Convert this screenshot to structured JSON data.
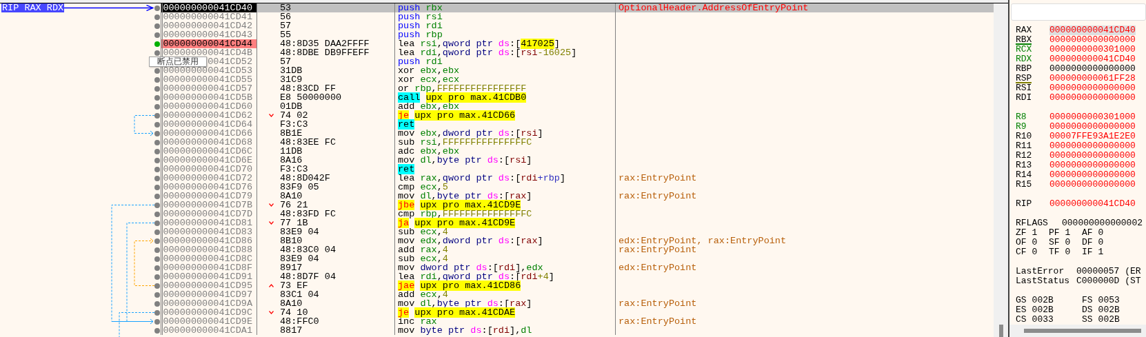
{
  "gutter": {
    "rip_label": "RIP RAX RDX"
  },
  "rows": [
    {
      "address": "000000000041CD40",
      "bytes": "53",
      "mnemonic": {
        "text": "push",
        "kind": "stack"
      },
      "operands": [
        {
          "text": "rbx",
          "kind": "reg"
        }
      ],
      "comment": {
        "text": "OptionalHeader.AddressOfEntryPoint",
        "kind": "label"
      },
      "selected": true,
      "current": true,
      "breakpoint": false
    },
    {
      "address": "000000000041CD41",
      "bytes": "56",
      "mnemonic": {
        "text": "push",
        "kind": "stack"
      },
      "operands": [
        {
          "text": "rsi",
          "kind": "reg"
        }
      ],
      "selected": false,
      "current": false,
      "breakpoint": false
    },
    {
      "address": "000000000041CD42",
      "bytes": "57",
      "mnemonic": {
        "text": "push",
        "kind": "stack"
      },
      "operands": [
        {
          "text": "rdi",
          "kind": "reg"
        }
      ],
      "selected": false,
      "current": false,
      "breakpoint": false
    },
    {
      "address": "000000000041CD43",
      "bytes": "55",
      "mnemonic": {
        "text": "push",
        "kind": "stack"
      },
      "operands": [
        {
          "text": "rbp",
          "kind": "reg"
        }
      ],
      "selected": false,
      "current": false,
      "breakpoint": false
    },
    {
      "address": "000000000041CD44",
      "bytes": "48:8D35 DAA2FFFF",
      "mnemonic": {
        "text": "lea",
        "kind": "plain"
      },
      "operands": [
        {
          "text": "rsi",
          "kind": "reg"
        },
        {
          "text": ",",
          "kind": "p"
        },
        {
          "text": "qword ptr ",
          "kind": "size"
        },
        {
          "text": "ds",
          "kind": "seg"
        },
        {
          "text": ":[",
          "kind": "p"
        },
        {
          "text": "417025",
          "kind": "mark"
        },
        {
          "text": "]",
          "kind": "p"
        }
      ],
      "selected": false,
      "current": false,
      "breakpoint": true
    },
    {
      "address": "000000000041CD4B",
      "bytes": "48:8DBE DB9FFEFF",
      "mnemonic": {
        "text": "lea",
        "kind": "plain"
      },
      "operands": [
        {
          "text": "rdi",
          "kind": "reg"
        },
        {
          "text": ",",
          "kind": "p"
        },
        {
          "text": "qword ptr ",
          "kind": "size"
        },
        {
          "text": "ds",
          "kind": "seg"
        },
        {
          "text": ":[",
          "kind": "p"
        },
        {
          "text": "rsi",
          "kind": "mem"
        },
        {
          "text": "-16025",
          "kind": "num"
        },
        {
          "text": "]",
          "kind": "p"
        }
      ],
      "selected": false,
      "current": false,
      "breakpoint": false
    },
    {
      "address": "0041CD52",
      "bytes": "57",
      "mnemonic": {
        "text": "push",
        "kind": "stack"
      },
      "operands": [
        {
          "text": "rdi",
          "kind": "reg"
        }
      ],
      "tooltip": "断点已禁用",
      "selected": false,
      "current": false,
      "breakpoint": false
    },
    {
      "address": "000000000041CD53",
      "bytes": "31DB",
      "mnemonic": {
        "text": "xor",
        "kind": "plain"
      },
      "operands": [
        {
          "text": "ebx",
          "kind": "reg"
        },
        {
          "text": ",",
          "kind": "p"
        },
        {
          "text": "ebx",
          "kind": "reg"
        }
      ],
      "selected": false,
      "current": false,
      "breakpoint": false
    },
    {
      "address": "000000000041CD55",
      "bytes": "31C9",
      "mnemonic": {
        "text": "xor",
        "kind": "plain"
      },
      "operands": [
        {
          "text": "ecx",
          "kind": "reg"
        },
        {
          "text": ",",
          "kind": "p"
        },
        {
          "text": "ecx",
          "kind": "reg"
        }
      ],
      "selected": false,
      "current": false,
      "breakpoint": false
    },
    {
      "address": "000000000041CD57",
      "bytes": "48:83CD FF",
      "mnemonic": {
        "text": "or",
        "kind": "plain"
      },
      "operands": [
        {
          "text": "rbp",
          "kind": "reg"
        },
        {
          "text": ",",
          "kind": "p"
        },
        {
          "text": "FFFFFFFFFFFFFFFF",
          "kind": "num"
        }
      ],
      "selected": false,
      "current": false,
      "breakpoint": false
    },
    {
      "address": "000000000041CD5B",
      "bytes": "E8 50000000",
      "mnemonic": {
        "text": "call",
        "kind": "call"
      },
      "operands": [
        {
          "text": "upx pro max.41CDB0",
          "kind": "target"
        }
      ],
      "selected": false,
      "current": false,
      "breakpoint": false
    },
    {
      "address": "000000000041CD60",
      "bytes": "01DB",
      "mnemonic": {
        "text": "add",
        "kind": "plain"
      },
      "operands": [
        {
          "text": "ebx",
          "kind": "reg"
        },
        {
          "text": ",",
          "kind": "p"
        },
        {
          "text": "ebx",
          "kind": "reg"
        }
      ],
      "selected": false,
      "current": false,
      "breakpoint": false
    },
    {
      "address": "000000000041CD62",
      "bytes": "74 02",
      "backward": false,
      "mnemonic": {
        "text": "je",
        "kind": "jump"
      },
      "operands": [
        {
          "text": "upx pro max.41CD66",
          "kind": "target"
        }
      ],
      "selected": false,
      "current": false,
      "breakpoint": false
    },
    {
      "address": "000000000041CD64",
      "bytes": "F3:C3",
      "mnemonic": {
        "text": "ret",
        "kind": "call"
      },
      "selected": false,
      "current": false,
      "breakpoint": false
    },
    {
      "address": "000000000041CD66",
      "bytes": "8B1E",
      "mnemonic": {
        "text": "mov",
        "kind": "plain"
      },
      "operands": [
        {
          "text": "ebx",
          "kind": "reg"
        },
        {
          "text": ",",
          "kind": "p"
        },
        {
          "text": "dword ptr ",
          "kind": "size"
        },
        {
          "text": "ds",
          "kind": "seg"
        },
        {
          "text": ":[",
          "kind": "p"
        },
        {
          "text": "rsi",
          "kind": "mem"
        },
        {
          "text": "]",
          "kind": "p"
        }
      ],
      "selected": false,
      "current": false,
      "breakpoint": false
    },
    {
      "address": "000000000041CD68",
      "bytes": "48:83EE FC",
      "mnemonic": {
        "text": "sub",
        "kind": "plain"
      },
      "operands": [
        {
          "text": "rsi",
          "kind": "reg"
        },
        {
          "text": ",",
          "kind": "p"
        },
        {
          "text": "FFFFFFFFFFFFFFFC",
          "kind": "num"
        }
      ],
      "selected": false,
      "current": false,
      "breakpoint": false
    },
    {
      "address": "000000000041CD6C",
      "bytes": "11DB",
      "mnemonic": {
        "text": "adc",
        "kind": "plain"
      },
      "operands": [
        {
          "text": "ebx",
          "kind": "reg"
        },
        {
          "text": ",",
          "kind": "p"
        },
        {
          "text": "ebx",
          "kind": "reg"
        }
      ],
      "selected": false,
      "current": false,
      "breakpoint": false
    },
    {
      "address": "000000000041CD6E",
      "bytes": "8A16",
      "mnemonic": {
        "text": "mov",
        "kind": "plain"
      },
      "operands": [
        {
          "text": "dl",
          "kind": "reg"
        },
        {
          "text": ",",
          "kind": "p"
        },
        {
          "text": "byte ptr ",
          "kind": "size"
        },
        {
          "text": "ds",
          "kind": "seg"
        },
        {
          "text": ":[",
          "kind": "p"
        },
        {
          "text": "rsi",
          "kind": "mem"
        },
        {
          "text": "]",
          "kind": "p"
        }
      ],
      "selected": false,
      "current": false,
      "breakpoint": false
    },
    {
      "address": "000000000041CD70",
      "bytes": "F3:C3",
      "mnemonic": {
        "text": "ret",
        "kind": "call"
      },
      "selected": false,
      "current": false,
      "breakpoint": false
    },
    {
      "address": "000000000041CD72",
      "bytes": "48:8D042F",
      "mnemonic": {
        "text": "lea",
        "kind": "plain"
      },
      "operands": [
        {
          "text": "rax",
          "kind": "reg"
        },
        {
          "text": ",",
          "kind": "p"
        },
        {
          "text": "qword ptr ",
          "kind": "size"
        },
        {
          "text": "ds",
          "kind": "seg"
        },
        {
          "text": ":[",
          "kind": "p"
        },
        {
          "text": "rdi",
          "kind": "mem"
        },
        {
          "text": "+rbp",
          "kind": "index"
        },
        {
          "text": "]",
          "kind": "p"
        }
      ],
      "comment": {
        "text": "rax:EntryPoint",
        "kind": "auto"
      },
      "selected": false,
      "current": false,
      "breakpoint": false
    },
    {
      "address": "000000000041CD76",
      "bytes": "83F9 05",
      "mnemonic": {
        "text": "cmp",
        "kind": "plain"
      },
      "operands": [
        {
          "text": "ecx",
          "kind": "reg"
        },
        {
          "text": ",",
          "kind": "p"
        },
        {
          "text": "5",
          "kind": "num"
        }
      ],
      "selected": false,
      "current": false,
      "breakpoint": false
    },
    {
      "address": "000000000041CD79",
      "bytes": "8A10",
      "mnemonic": {
        "text": "mov",
        "kind": "plain"
      },
      "operands": [
        {
          "text": "dl",
          "kind": "reg"
        },
        {
          "text": ",",
          "kind": "p"
        },
        {
          "text": "byte ptr ",
          "kind": "size"
        },
        {
          "text": "ds",
          "kind": "seg"
        },
        {
          "text": ":[",
          "kind": "p"
        },
        {
          "text": "rax",
          "kind": "mem"
        },
        {
          "text": "]",
          "kind": "p"
        }
      ],
      "comment": {
        "text": "rax:EntryPoint",
        "kind": "auto"
      },
      "selected": false,
      "current": false,
      "breakpoint": false
    },
    {
      "address": "000000000041CD7B",
      "bytes": "76 21",
      "backward": false,
      "mnemonic": {
        "text": "jbe",
        "kind": "jump"
      },
      "operands": [
        {
          "text": "upx pro max.41CD9E",
          "kind": "target"
        }
      ],
      "selected": false,
      "current": false,
      "breakpoint": false
    },
    {
      "address": "000000000041CD7D",
      "bytes": "48:83FD FC",
      "mnemonic": {
        "text": "cmp",
        "kind": "plain"
      },
      "operands": [
        {
          "text": "rbp",
          "kind": "reg"
        },
        {
          "text": ",",
          "kind": "p"
        },
        {
          "text": "FFFFFFFFFFFFFFFC",
          "kind": "num"
        }
      ],
      "selected": false,
      "current": false,
      "breakpoint": false
    },
    {
      "address": "000000000041CD81",
      "bytes": "77 1B",
      "backward": false,
      "mnemonic": {
        "text": "ja",
        "kind": "jump"
      },
      "operands": [
        {
          "text": "upx pro max.41CD9E",
          "kind": "target"
        }
      ],
      "selected": false,
      "current": false,
      "breakpoint": false
    },
    {
      "address": "000000000041CD83",
      "bytes": "83E9 04",
      "mnemonic": {
        "text": "sub",
        "kind": "plain"
      },
      "operands": [
        {
          "text": "ecx",
          "kind": "reg"
        },
        {
          "text": ",",
          "kind": "p"
        },
        {
          "text": "4",
          "kind": "num"
        }
      ],
      "selected": false,
      "current": false,
      "breakpoint": false
    },
    {
      "address": "000000000041CD86",
      "bytes": "8B10",
      "mnemonic": {
        "text": "mov",
        "kind": "plain"
      },
      "operands": [
        {
          "text": "edx",
          "kind": "reg"
        },
        {
          "text": ",",
          "kind": "p"
        },
        {
          "text": "dword ptr ",
          "kind": "size"
        },
        {
          "text": "ds",
          "kind": "seg"
        },
        {
          "text": ":[",
          "kind": "p"
        },
        {
          "text": "rax",
          "kind": "mem"
        },
        {
          "text": "]",
          "kind": "p"
        }
      ],
      "comment": {
        "text": "edx:EntryPoint, rax:EntryPoint",
        "kind": "auto"
      },
      "selected": false,
      "current": false,
      "breakpoint": false
    },
    {
      "address": "000000000041CD88",
      "bytes": "48:83C0 04",
      "mnemonic": {
        "text": "add",
        "kind": "plain"
      },
      "operands": [
        {
          "text": "rax",
          "kind": "reg"
        },
        {
          "text": ",",
          "kind": "p"
        },
        {
          "text": "4",
          "kind": "num"
        }
      ],
      "comment": {
        "text": "rax:EntryPoint",
        "kind": "auto"
      },
      "selected": false,
      "current": false,
      "breakpoint": false
    },
    {
      "address": "000000000041CD8C",
      "bytes": "83E9 04",
      "mnemonic": {
        "text": "sub",
        "kind": "plain"
      },
      "operands": [
        {
          "text": "ecx",
          "kind": "reg"
        },
        {
          "text": ",",
          "kind": "p"
        },
        {
          "text": "4",
          "kind": "num"
        }
      ],
      "selected": false,
      "current": false,
      "breakpoint": false
    },
    {
      "address": "000000000041CD8F",
      "bytes": "8917",
      "mnemonic": {
        "text": "mov",
        "kind": "plain"
      },
      "operands": [
        {
          "text": "dword ptr ",
          "kind": "size"
        },
        {
          "text": "ds",
          "kind": "seg"
        },
        {
          "text": ":[",
          "kind": "p"
        },
        {
          "text": "rdi",
          "kind": "mem"
        },
        {
          "text": "],",
          "kind": "p"
        },
        {
          "text": "edx",
          "kind": "reg"
        }
      ],
      "comment": {
        "text": "edx:EntryPoint",
        "kind": "auto"
      },
      "selected": false,
      "current": false,
      "breakpoint": false
    },
    {
      "address": "000000000041CD91",
      "bytes": "48:8D7F 04",
      "mnemonic": {
        "text": "lea",
        "kind": "plain"
      },
      "operands": [
        {
          "text": "rdi",
          "kind": "reg"
        },
        {
          "text": ",",
          "kind": "p"
        },
        {
          "text": "qword ptr ",
          "kind": "size"
        },
        {
          "text": "ds",
          "kind": "seg"
        },
        {
          "text": ":[",
          "kind": "p"
        },
        {
          "text": "rdi",
          "kind": "mem"
        },
        {
          "text": "+4",
          "kind": "num"
        },
        {
          "text": "]",
          "kind": "p"
        }
      ],
      "selected": false,
      "current": false,
      "breakpoint": false
    },
    {
      "address": "000000000041CD95",
      "bytes": "73 EF",
      "backward": true,
      "mnemonic": {
        "text": "jae",
        "kind": "jump"
      },
      "operands": [
        {
          "text": "upx pro max.41CD86",
          "kind": "target"
        }
      ],
      "selected": false,
      "current": false,
      "breakpoint": false
    },
    {
      "address": "000000000041CD97",
      "bytes": "83C1 04",
      "mnemonic": {
        "text": "add",
        "kind": "plain"
      },
      "operands": [
        {
          "text": "ecx",
          "kind": "reg"
        },
        {
          "text": ",",
          "kind": "p"
        },
        {
          "text": "4",
          "kind": "num"
        }
      ],
      "selected": false,
      "current": false,
      "breakpoint": false
    },
    {
      "address": "000000000041CD9A",
      "bytes": "8A10",
      "mnemonic": {
        "text": "mov",
        "kind": "plain"
      },
      "operands": [
        {
          "text": "dl",
          "kind": "reg"
        },
        {
          "text": ",",
          "kind": "p"
        },
        {
          "text": "byte ptr ",
          "kind": "size"
        },
        {
          "text": "ds",
          "kind": "seg"
        },
        {
          "text": ":[",
          "kind": "p"
        },
        {
          "text": "rax",
          "kind": "mem"
        },
        {
          "text": "]",
          "kind": "p"
        }
      ],
      "comment": {
        "text": "rax:EntryPoint",
        "kind": "auto"
      },
      "selected": false,
      "current": false,
      "breakpoint": false
    },
    {
      "address": "000000000041CD9C",
      "bytes": "74 10",
      "backward": false,
      "mnemonic": {
        "text": "je",
        "kind": "jump"
      },
      "operands": [
        {
          "text": "upx pro max.41CDAE",
          "kind": "target"
        }
      ],
      "selected": false,
      "current": false,
      "breakpoint": false
    },
    {
      "address": "000000000041CD9E",
      "bytes": "48:FFC0",
      "mnemonic": {
        "text": "inc",
        "kind": "plain"
      },
      "operands": [
        {
          "text": "rax",
          "kind": "reg"
        }
      ],
      "comment": {
        "text": "rax:EntryPoint",
        "kind": "auto"
      },
      "selected": false,
      "current": false,
      "breakpoint": false
    },
    {
      "address": "000000000041CDA1",
      "bytes": "8817",
      "mnemonic": {
        "text": "mov",
        "kind": "plain"
      },
      "operands": [
        {
          "text": "byte ptr ",
          "kind": "size"
        },
        {
          "text": "ds",
          "kind": "seg"
        },
        {
          "text": ":[",
          "kind": "p"
        },
        {
          "text": "rdi",
          "kind": "mem"
        },
        {
          "text": "],",
          "kind": "p"
        },
        {
          "text": "dl",
          "kind": "reg"
        }
      ],
      "selected": false,
      "current": false,
      "breakpoint": false
    }
  ],
  "registers": {
    "general": [
      {
        "name": "RAX",
        "value": "000000000041CD40",
        "changed": true,
        "argument": false,
        "selected": true
      },
      {
        "name": "RBX",
        "value": "0000000000000000",
        "changed": true,
        "argument": false,
        "selected": false,
        "color": "#008000"
      },
      {
        "name": "RCX",
        "value": "0000000000301000",
        "changed": true,
        "argument": true,
        "selected": false
      },
      {
        "name": "RDX",
        "value": "000000000041CD40",
        "changed": true,
        "argument": true,
        "selected": false
      },
      {
        "name": "RBP",
        "value": "0000000000000000",
        "changed": false,
        "argument": false,
        "selected": false
      },
      {
        "name": "RSP",
        "value": "000000000061FF28",
        "changed": true,
        "argument": false,
        "selected": false,
        "color": "#808000"
      },
      {
        "name": "RSI",
        "value": "0000000000000000",
        "changed": true,
        "argument": false,
        "selected": false
      },
      {
        "name": "RDI",
        "value": "0000000000000000",
        "changed": true,
        "argument": false,
        "selected": false
      }
    ],
    "extended": [
      {
        "name": "R8",
        "value": "0000000000301000",
        "changed": true,
        "argument": true,
        "selected": false
      },
      {
        "name": "R9",
        "value": "0000000000000000",
        "changed": true,
        "argument": true,
        "selected": false
      },
      {
        "name": "R10",
        "value": "00007FFE93A1E2E0",
        "changed": true,
        "argument": false,
        "selected": false
      },
      {
        "name": "R11",
        "value": "0000000000000000",
        "changed": true,
        "argument": false,
        "selected": false
      },
      {
        "name": "R12",
        "value": "0000000000000000",
        "changed": true,
        "argument": false,
        "selected": false
      },
      {
        "name": "R13",
        "value": "0000000000000000",
        "changed": true,
        "argument": false,
        "selected": false
      },
      {
        "name": "R14",
        "value": "0000000000000000",
        "changed": true,
        "argument": false,
        "selected": false
      },
      {
        "name": "R15",
        "value": "0000000000000000",
        "changed": true,
        "argument": false,
        "selected": false
      }
    ],
    "instruction_pointer": [
      {
        "name": "RIP",
        "value": "000000000041CD40",
        "changed": true,
        "argument": false,
        "selected": false
      }
    ],
    "rflags": {
      "name": "RFLAGS",
      "value": "000000000000002"
    },
    "flag_rows": [
      {
        "flags": [
          {
            "name": "ZF",
            "value": "1"
          },
          {
            "name": "PF",
            "value": "1"
          },
          {
            "name": "AF",
            "value": "0"
          }
        ]
      },
      {
        "flags": [
          {
            "name": "OF",
            "value": "0"
          },
          {
            "name": "SF",
            "value": "0"
          },
          {
            "name": "DF",
            "value": "0"
          }
        ]
      },
      {
        "flags": [
          {
            "name": "CF",
            "value": "0"
          },
          {
            "name": "TF",
            "value": "0"
          },
          {
            "name": "IF",
            "value": "1"
          }
        ]
      }
    ],
    "last": [
      {
        "name": "LastError",
        "value": "00000057 (ER"
      },
      {
        "name": "LastStatus",
        "value": "C000000D (ST"
      }
    ],
    "segment_rows": [
      {
        "segments": [
          {
            "name": "GS",
            "value": "002B"
          },
          {
            "name": "FS",
            "value": "0053"
          }
        ]
      },
      {
        "segments": [
          {
            "name": "ES",
            "value": "002B"
          },
          {
            "name": "DS",
            "value": "002B"
          }
        ]
      },
      {
        "segments": [
          {
            "name": "CS",
            "value": "0033"
          },
          {
            "name": "SS",
            "value": "002B"
          }
        ]
      }
    ]
  }
}
